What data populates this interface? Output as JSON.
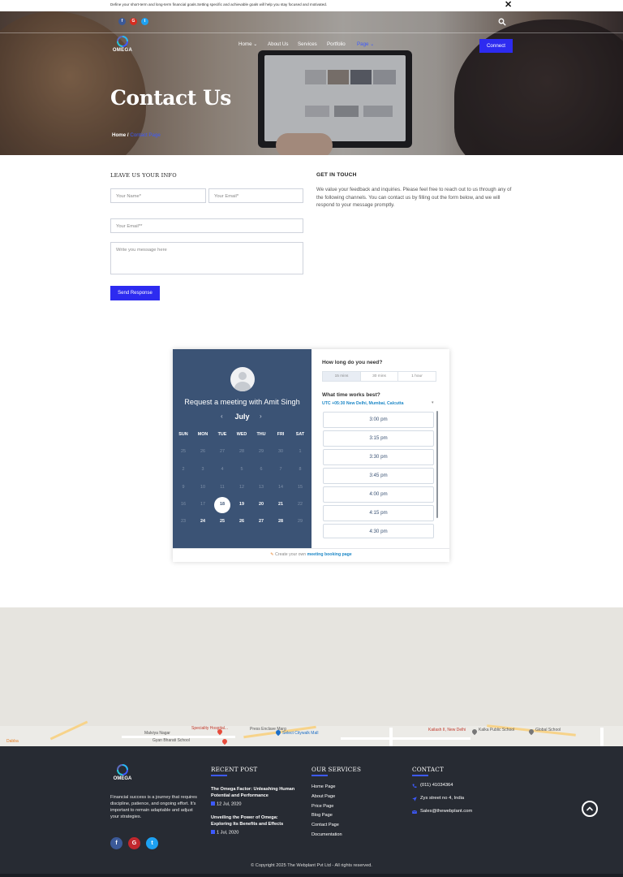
{
  "topbar": {
    "message": "Define your short-term and long-term financial goals.Setting specific and achievable goals will help you stay focused and motivated.",
    "close_icon": "close-icon"
  },
  "header": {
    "social": [
      "facebook-icon",
      "google-plus-icon",
      "twitter-icon"
    ],
    "search_icon": "search-icon",
    "logo_text": "OMEGA",
    "nav": [
      {
        "label": "Home",
        "dropdown": true
      },
      {
        "label": "About Us",
        "dropdown": false
      },
      {
        "label": "Services",
        "dropdown": false
      },
      {
        "label": "Portfolio",
        "dropdown": false
      },
      {
        "label": "Page",
        "dropdown": true,
        "active": true
      }
    ],
    "connect_label": "Connect",
    "colors": {
      "accent": "#2d2bf0",
      "active_link": "#3d5afe"
    }
  },
  "hero": {
    "title": "Contact Us",
    "breadcrumb_home": "Home /",
    "breadcrumb_current": "Contact Page"
  },
  "form": {
    "heading": "LEAVE US YOUR INFO",
    "name_placeholder": "Your Name*",
    "email_placeholder": "Your Email*",
    "email2_placeholder": "Your Email**",
    "message_placeholder": "Write you message here",
    "submit_label": "Send Response"
  },
  "touch": {
    "heading": "GET IN TOUCH",
    "text": "We value your feedback and inquiries. Please feel free to reach out to us through any of the following channels. You can contact us by filling out the form below, and we will respond to your message promptly."
  },
  "booking": {
    "request_text": "Request a meeting with Amit Singh",
    "month": "July",
    "prev_icon": "chevron-left-icon",
    "next_icon": "chevron-right-icon",
    "weekdays": [
      "SUN",
      "MON",
      "TUE",
      "WED",
      "THU",
      "FRI",
      "SAT"
    ],
    "weeks": [
      [
        {
          "d": "25",
          "on": false
        },
        {
          "d": "26",
          "on": false
        },
        {
          "d": "27",
          "on": false
        },
        {
          "d": "28",
          "on": false
        },
        {
          "d": "29",
          "on": false
        },
        {
          "d": "30",
          "on": false
        },
        {
          "d": "1",
          "on": false
        }
      ],
      [
        {
          "d": "2",
          "on": false
        },
        {
          "d": "3",
          "on": false
        },
        {
          "d": "4",
          "on": false
        },
        {
          "d": "5",
          "on": false
        },
        {
          "d": "6",
          "on": false
        },
        {
          "d": "7",
          "on": false
        },
        {
          "d": "8",
          "on": false
        }
      ],
      [
        {
          "d": "9",
          "on": false
        },
        {
          "d": "10",
          "on": false
        },
        {
          "d": "11",
          "on": false
        },
        {
          "d": "12",
          "on": false
        },
        {
          "d": "13",
          "on": false
        },
        {
          "d": "14",
          "on": false
        },
        {
          "d": "15",
          "on": false
        }
      ],
      [
        {
          "d": "16",
          "on": false
        },
        {
          "d": "17",
          "on": false
        },
        {
          "d": "18",
          "on": true,
          "selected": true
        },
        {
          "d": "19",
          "on": true
        },
        {
          "d": "20",
          "on": true
        },
        {
          "d": "21",
          "on": true
        },
        {
          "d": "22",
          "on": false
        }
      ],
      [
        {
          "d": "23",
          "on": false
        },
        {
          "d": "24",
          "on": true
        },
        {
          "d": "25",
          "on": true
        },
        {
          "d": "26",
          "on": true
        },
        {
          "d": "27",
          "on": true
        },
        {
          "d": "28",
          "on": true
        },
        {
          "d": "29",
          "on": false
        }
      ]
    ],
    "duration_question": "How long do you need?",
    "durations": [
      {
        "label": "15 mins",
        "selected": true
      },
      {
        "label": "30 mins",
        "selected": false
      },
      {
        "label": "1 hour",
        "selected": false
      }
    ],
    "time_question": "What time works best?",
    "timezone": "UTC +05:30 New Delhi, Mumbai, Calcutta",
    "slots": [
      "3:00 pm",
      "3:15 pm",
      "3:30 pm",
      "3:45 pm",
      "4:00 pm",
      "4:15 pm",
      "4:30 pm"
    ],
    "footer_prefix": "Create your own",
    "footer_link": "meeting booking page"
  },
  "map": {
    "labels": [
      "Speciality Hospital...",
      "Press Enclave Marg",
      "Malviya Nagar",
      "Gyan Bharati School",
      "Select Citywalk Mall",
      "Kailash II, New Delhi",
      "Kalka Public School",
      "Global School",
      "Dabba"
    ]
  },
  "footer": {
    "logo_text": "OMEGA",
    "about": "Financial success is a journey that requires discipline, patience, and ongoing effort. It's important to remain adaptable and adjust your strategies.",
    "recent_heading": "RECENT POST",
    "posts": [
      {
        "title": "The Omega Factor: Unleashing Human Potential and Performance",
        "date": "12 Jul, 2020"
      },
      {
        "title": "Unveiling the Power of Omega: Exploring Its Benefits and Effects",
        "date": "1 Jul, 2020"
      }
    ],
    "services_heading": "OUR SERVICES",
    "services": [
      "Home Page",
      "About Page",
      "Price Page",
      "Blog Page",
      "Contact Page",
      "Documentation"
    ],
    "contact_heading": "CONTACT",
    "phone": "(011) 41034364",
    "address": "Zys street no 4, India",
    "email": "Sales@thewebplant.com",
    "social": [
      "facebook-icon",
      "google-plus-icon",
      "twitter-icon"
    ],
    "copyright": "© Copyright 2025 The Webplant Pvt Ltd - All rights reserved."
  }
}
